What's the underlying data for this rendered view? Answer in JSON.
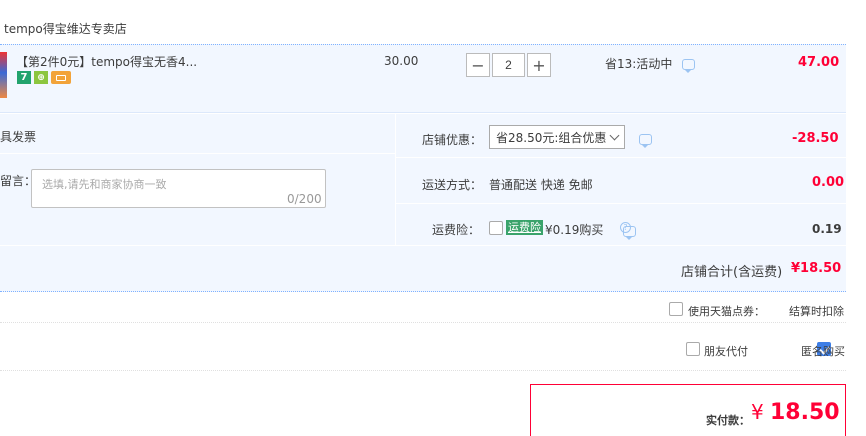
{
  "shop": {
    "name": "tempo得宝维达专卖店"
  },
  "item": {
    "title": "【第2件0元】tempo得宝无香4...",
    "badges": {
      "b1": "7",
      "b2": "⊕"
    },
    "unit_price": "30.00",
    "quantity": "2",
    "minus": "−",
    "plus": "+",
    "promo": "省13:活动中",
    "total": "47.00"
  },
  "options": {
    "invoice_label": "具发票",
    "message_label": "留言：",
    "message_placeholder": "选填,请先和商家协商一致",
    "message_count": "0/200",
    "shop_discount_label": "店铺优惠：",
    "shop_discount_value": "省28.50元:组合优惠",
    "shop_discount_amount": "-28.50",
    "shipping_label": "运送方式：",
    "shipping_value": "普通配送 快递 免邮",
    "shipping_amount": "0.00",
    "insurance_label": "运费险：",
    "insurance_tag": "运费险",
    "insurance_text": "¥0.19购买",
    "insurance_amount": "0.19"
  },
  "shop_total": {
    "label": "店铺合计(含运费)",
    "value": "¥18.50"
  },
  "tmall_points": {
    "label": "使用天猫点券：",
    "note": "结算时扣除"
  },
  "friend_pay": {
    "label": "朋友代付"
  },
  "anonymous": {
    "label": "匿名购买",
    "checked": true
  },
  "payment": {
    "label": "实付款：",
    "currency": "¥",
    "amount": "18.50"
  },
  "colors": {
    "accent": "#ff0036",
    "blue_bg": "#f2f7ff",
    "checkbox_blue": "#3d7ee6",
    "insurance_green": "#3aa36b"
  }
}
